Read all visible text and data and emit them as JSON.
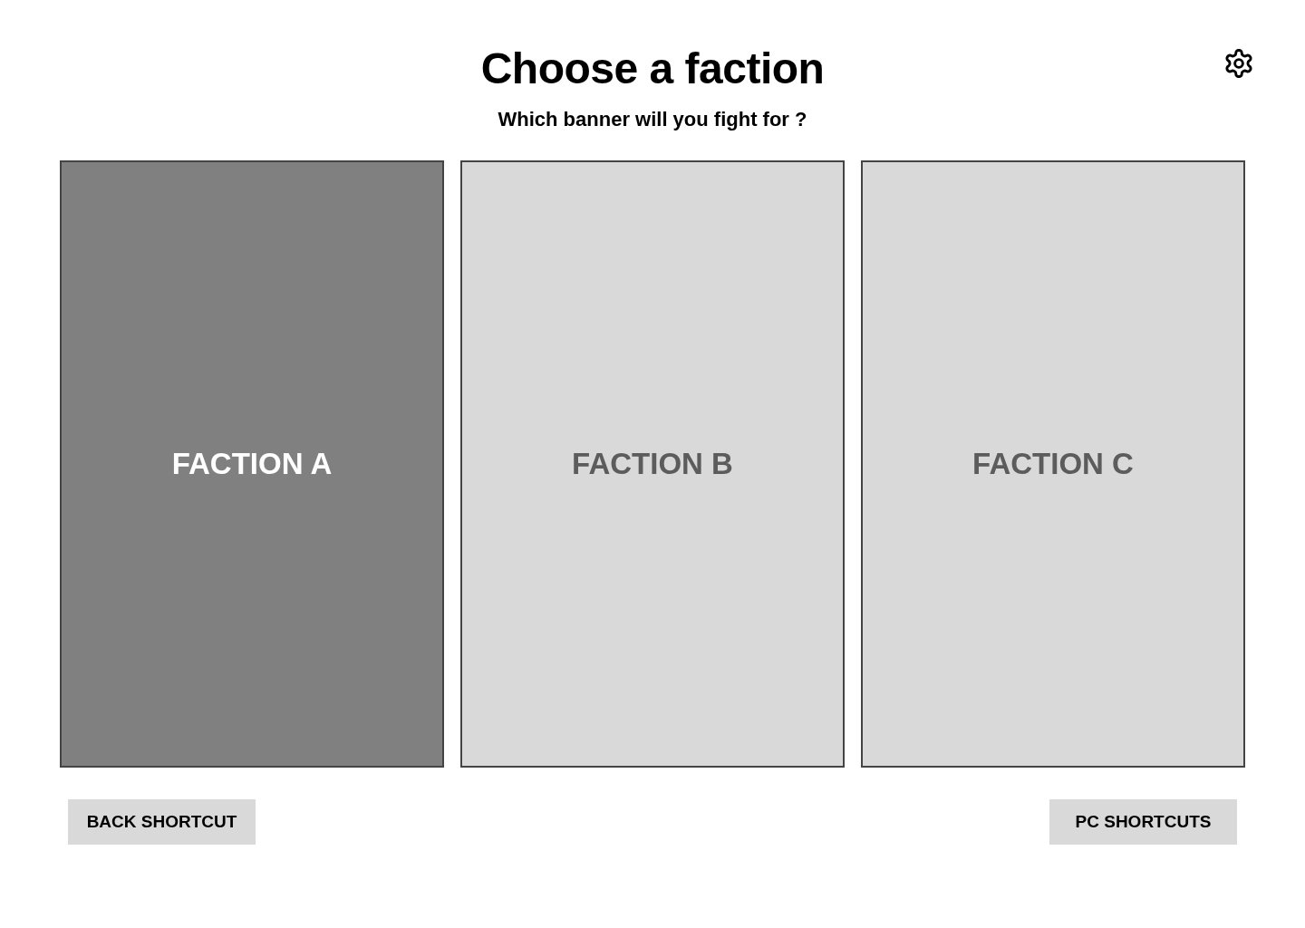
{
  "header": {
    "title": "Choose a faction",
    "subtitle": "Which banner will you fight for ?"
  },
  "factions": [
    {
      "label": "FACTION A",
      "selected": true
    },
    {
      "label": "FACTION B",
      "selected": false
    },
    {
      "label": "FACTION C",
      "selected": false
    }
  ],
  "footer": {
    "buttons": [
      {
        "label": "BACK SHORTCUT"
      },
      {
        "label": "PC SHORTCUTS"
      }
    ]
  }
}
